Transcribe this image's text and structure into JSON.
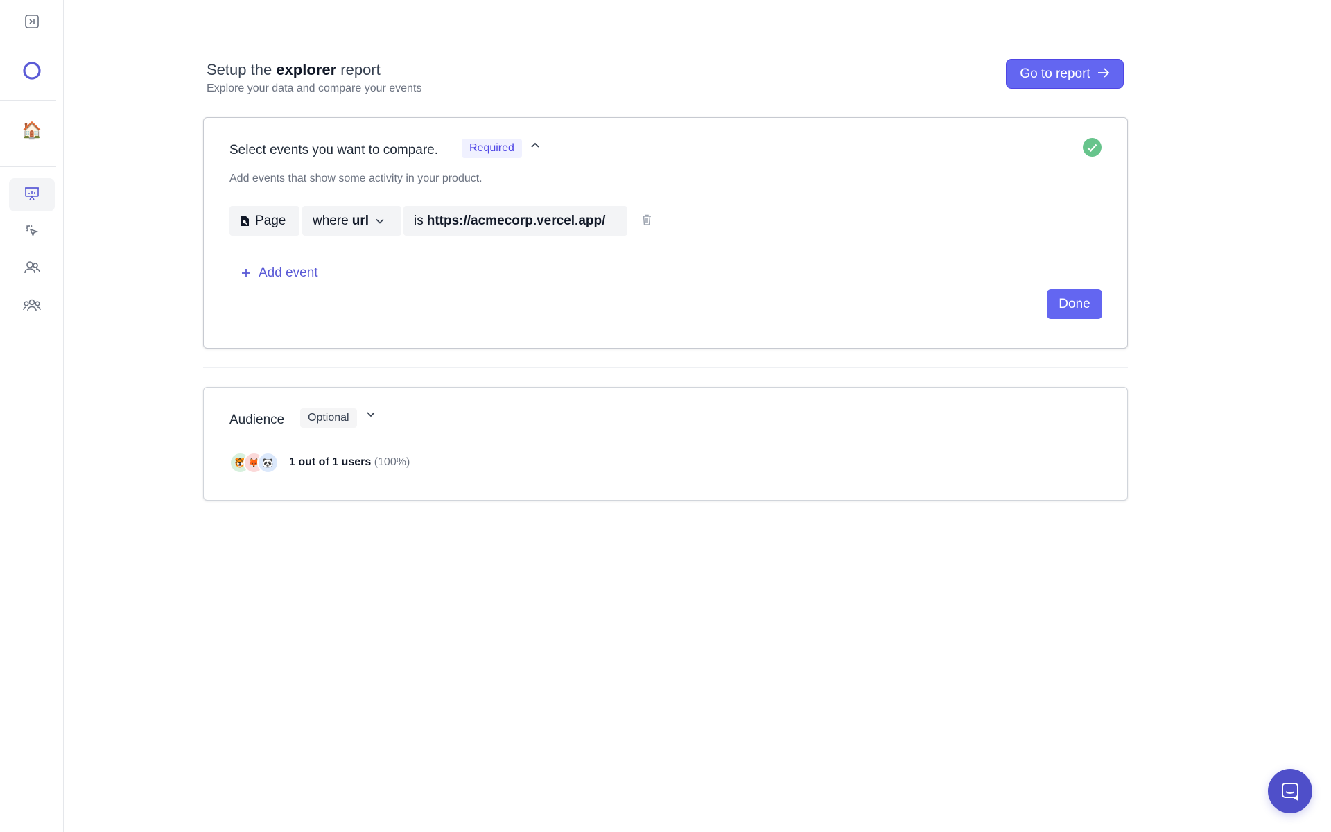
{
  "sidebar": {
    "items": [
      {
        "name": "sidebar-toggle",
        "icon": "sidebar-toggle-icon"
      },
      {
        "name": "logo",
        "icon": "ring-logo-icon"
      },
      {
        "name": "home",
        "icon": "house-icon"
      },
      {
        "name": "reports",
        "icon": "presentation-chart-icon",
        "active": true
      },
      {
        "name": "events",
        "icon": "cursor-click-icon"
      },
      {
        "name": "users",
        "icon": "users-icon"
      },
      {
        "name": "groups",
        "icon": "user-group-icon"
      }
    ]
  },
  "header": {
    "title_prefix": "Setup the",
    "title_bold": "explorer",
    "title_suffix": "report",
    "subtitle": "Explore your data and compare your events",
    "go_button": "Go to report"
  },
  "events_section": {
    "title": "Select events you want to compare.",
    "badge": "Required",
    "hint": "Add events that show some activity in your product.",
    "event": {
      "type_label": "Page",
      "where_prefix": "where",
      "where_field": "url",
      "is_prefix": "is",
      "is_value": "https://acmecorp.vercel.app/"
    },
    "add_event": "Add event",
    "done": "Done"
  },
  "audience_section": {
    "title": "Audience",
    "badge": "Optional",
    "count_text": "1 out of 1 users",
    "percent_text": "(100%)"
  },
  "colors": {
    "accent": "#6366f1",
    "success": "#67c48c",
    "chat": "#4f4fc9"
  }
}
